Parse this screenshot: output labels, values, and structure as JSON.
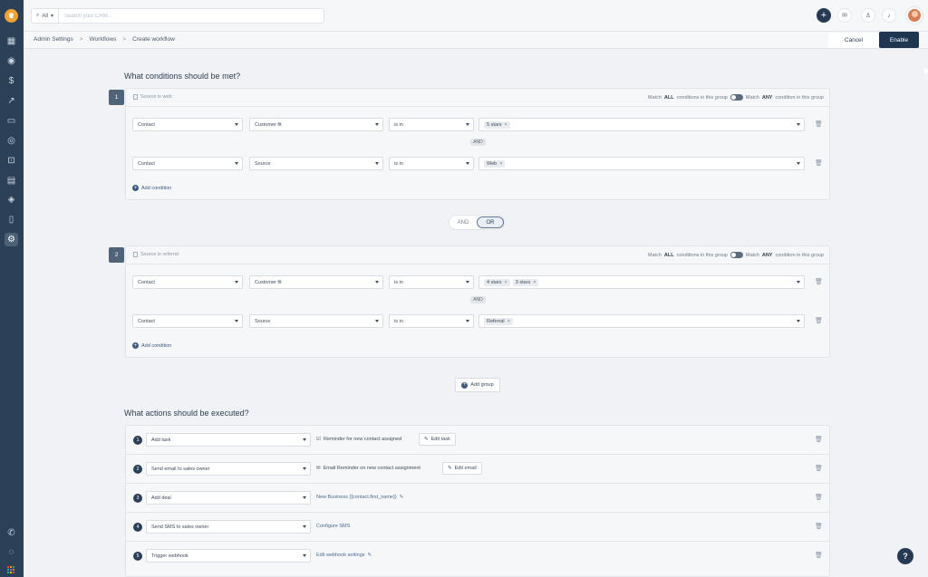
{
  "app": {
    "logo_letter": "♛",
    "sidebar_icons": [
      "calendar-icon",
      "contacts-icon",
      "dollar-icon",
      "chart-icon",
      "chat-icon",
      "target-icon",
      "inbox-icon",
      "reports-icon",
      "box-icon",
      "document-icon",
      "settings-icon",
      "phone-icon",
      "feedback-icon"
    ],
    "brand_colors": {
      "sidebar": "#2c4158",
      "primary": "#1f3651",
      "accent": "#f0a232"
    }
  },
  "search": {
    "scope": "All",
    "placeholder": "Search your CRM..."
  },
  "breadcrumb": {
    "item1": "Admin Settings",
    "item2": "Workflows",
    "item3": "Create workflow",
    "sep": ">"
  },
  "actions_top": {
    "cancel": "Cancel",
    "enable": "Enable"
  },
  "conditions": {
    "title": "What conditions should be met?",
    "match_prefix": "Match",
    "all": "ALL",
    "all_suffix": "conditions in this group",
    "any": "ANY",
    "any_suffix": "condition in this group",
    "and_badge": "AND",
    "add_condition": "Add condition",
    "group1": {
      "num": "1",
      "title": "Source is web",
      "rows": [
        {
          "entity": "Contact",
          "field": "Customer fit",
          "op": "is in",
          "chips": [
            "5 stars"
          ]
        },
        {
          "entity": "Contact",
          "field": "Source",
          "op": "is in",
          "chips": [
            "Web"
          ]
        }
      ]
    },
    "group2": {
      "num": "2",
      "title": "Source is referral",
      "rows": [
        {
          "entity": "Contact",
          "field": "Customer fit",
          "op": "is in",
          "chips": [
            "4 stars",
            "3 stars"
          ]
        },
        {
          "entity": "Contact",
          "field": "Source",
          "op": "is in",
          "chips": [
            "Referral"
          ]
        }
      ]
    },
    "andor": {
      "and": "AND",
      "or": "OR",
      "selected": "OR"
    },
    "add_group": "Add group"
  },
  "actions": {
    "title": "What actions should be executed?",
    "items": [
      {
        "num": "1",
        "action": "Add task",
        "detail": "Reminder for new contact assigned",
        "edit": "Edit task"
      },
      {
        "num": "2",
        "action": "Send email to sales owner",
        "detail": "Email Reminder on new contact assignment",
        "edit": "Edit email"
      },
      {
        "num": "3",
        "action": "Add deal",
        "detail": "New Business {{contact.first_name}}",
        "edit": ""
      },
      {
        "num": "4",
        "action": "Send SMS to sales owner",
        "detail": "Configure SMS",
        "edit": ""
      },
      {
        "num": "5",
        "action": "Trigger webhook",
        "detail": "Edit webhook settings",
        "edit": ""
      }
    ]
  },
  "help": "?"
}
